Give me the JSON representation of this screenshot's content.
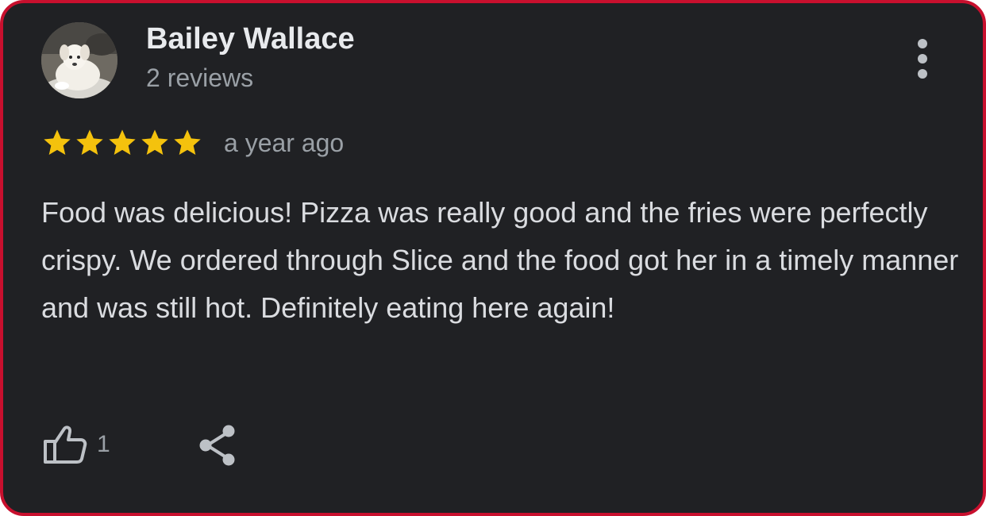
{
  "reviewer": {
    "name": "Bailey Wallace",
    "reviews_count": "2 reviews",
    "avatar_icon": "dog-photo-avatar"
  },
  "menu": {
    "icon": "more-vert-icon"
  },
  "rating": {
    "stars": 5,
    "max_stars": 5,
    "star_color": "#f4c20d",
    "time": "a year ago"
  },
  "review": {
    "text": "Food was delicious! Pizza was really good and the fries were perfectly crispy. We ordered through Slice and the food got her in a timely manner and was still hot. Definitely eating here again!"
  },
  "actions": {
    "like_icon": "thumbs-up-icon",
    "like_count": "1",
    "share_icon": "share-icon"
  },
  "colors": {
    "card_background": "#202124",
    "border": "#c8102e",
    "primary_text": "#e8eaed",
    "secondary_text": "#9aa0a6"
  }
}
